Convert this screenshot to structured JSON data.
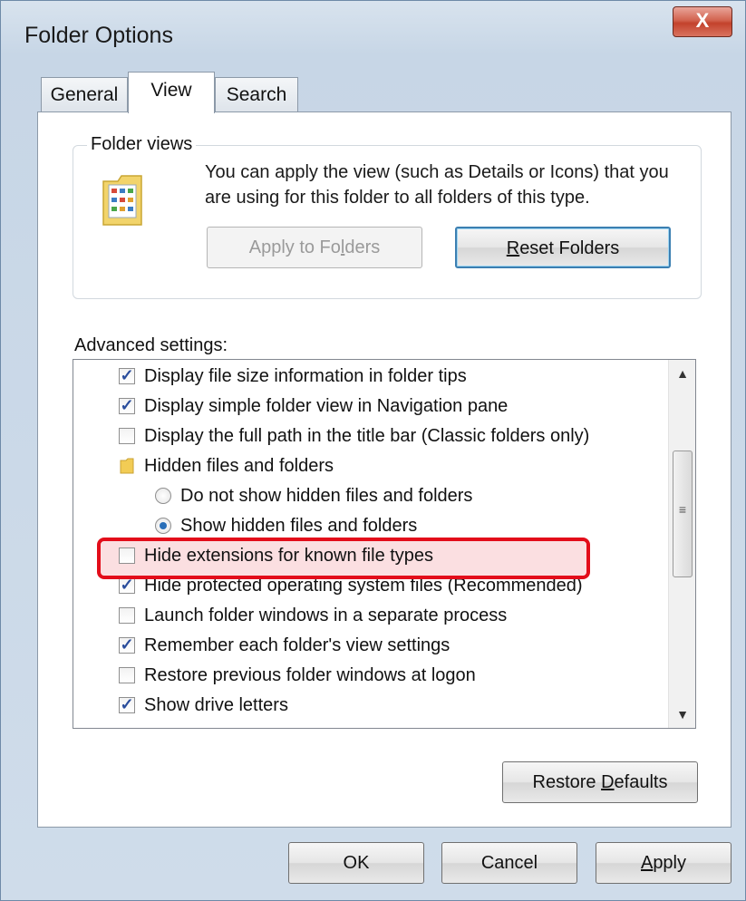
{
  "window": {
    "title": "Folder Options",
    "close_label": "X"
  },
  "tabs": [
    {
      "label": "General",
      "active": false
    },
    {
      "label": "View",
      "active": true
    },
    {
      "label": "Search",
      "active": false
    }
  ],
  "folder_views": {
    "group_label": "Folder views",
    "description": "You can apply the view (such as Details or Icons) that you are using for this folder to all folders of this type.",
    "apply_button": {
      "pre": "Apply to Fo",
      "accel": "l",
      "post": "ders"
    },
    "reset_button": {
      "pre": "",
      "accel": "R",
      "post": "eset Folders"
    }
  },
  "advanced": {
    "label": "Advanced settings:",
    "items": [
      {
        "type": "checkbox",
        "checked": true,
        "label": "Display file size information in folder tips"
      },
      {
        "type": "checkbox",
        "checked": true,
        "label": "Display simple folder view in Navigation pane"
      },
      {
        "type": "checkbox",
        "checked": false,
        "label": "Display the full path in the title bar (Classic folders only)"
      },
      {
        "type": "folder",
        "label": "Hidden files and folders"
      },
      {
        "type": "radio",
        "selected": false,
        "label": "Do not show hidden files and folders"
      },
      {
        "type": "radio",
        "selected": true,
        "label": "Show hidden files and folders"
      },
      {
        "type": "checkbox",
        "checked": false,
        "label": "Hide extensions for known file types",
        "highlighted": true
      },
      {
        "type": "checkbox",
        "checked": true,
        "label": "Hide protected operating system files (Recommended)"
      },
      {
        "type": "checkbox",
        "checked": false,
        "label": "Launch folder windows in a separate process"
      },
      {
        "type": "checkbox",
        "checked": true,
        "label": "Remember each folder's view settings"
      },
      {
        "type": "checkbox",
        "checked": false,
        "label": "Restore previous folder windows at logon"
      },
      {
        "type": "checkbox",
        "checked": true,
        "label": "Show drive letters"
      }
    ],
    "scroll_up": "▲",
    "scroll_down": "▼",
    "scroll_grip": "≡"
  },
  "restore_defaults": {
    "pre": "Restore ",
    "accel": "D",
    "post": "efaults"
  },
  "footer": {
    "ok": "OK",
    "cancel": "Cancel",
    "apply": {
      "pre": "",
      "accel": "A",
      "post": "pply"
    }
  },
  "colors": {
    "highlight": "#e30d1a",
    "accent": "#3c7fb1"
  }
}
